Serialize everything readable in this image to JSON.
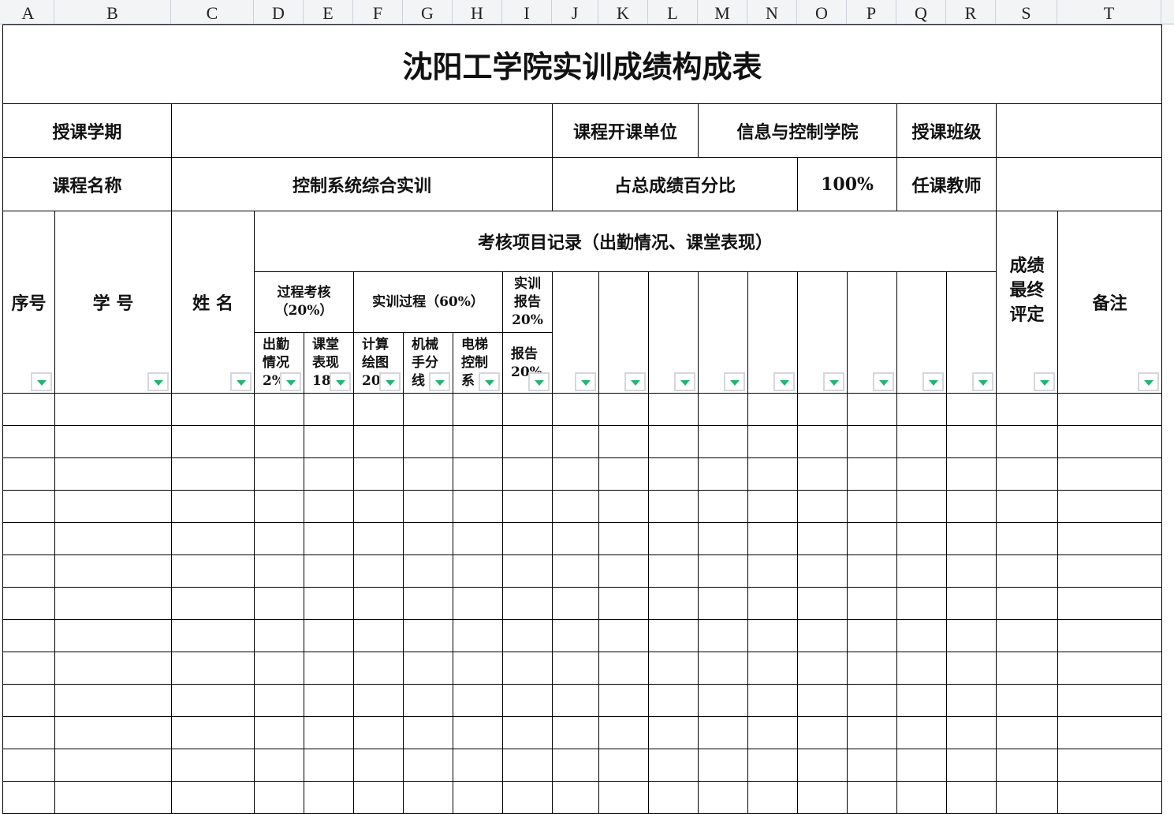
{
  "columns": [
    "A",
    "B",
    "C",
    "D",
    "E",
    "F",
    "G",
    "H",
    "I",
    "J",
    "K",
    "L",
    "M",
    "N",
    "O",
    "P",
    "Q",
    "R",
    "S",
    "T"
  ],
  "title": "沈阳工学院实训成绩构成表",
  "info": {
    "term_label": "授课学期",
    "term_value": "",
    "unit_label": "课程开课单位",
    "unit_value": "信息与控制学院",
    "class_label": "授课班级",
    "class_value": "",
    "course_label": "课程名称",
    "course_value": "控制系统综合实训",
    "percent_label": "占总成绩百分比",
    "percent_value": "100%",
    "teacher_label": "任课教师",
    "teacher_value": ""
  },
  "headers": {
    "seq": "序号",
    "student_id": "学 号",
    "name": "姓 名",
    "record": "考核项目记录（出勤情况、课堂表现）",
    "process": "过程考核（20%）",
    "training": "实训过程（60%）",
    "report": "实训报告20%",
    "final": "成绩最终评定",
    "remark": "备注",
    "sub": [
      "出勤情况2%",
      "课堂表现18",
      "计算绘图20",
      "机械手分线",
      "电梯控制系",
      "报告20%"
    ]
  }
}
